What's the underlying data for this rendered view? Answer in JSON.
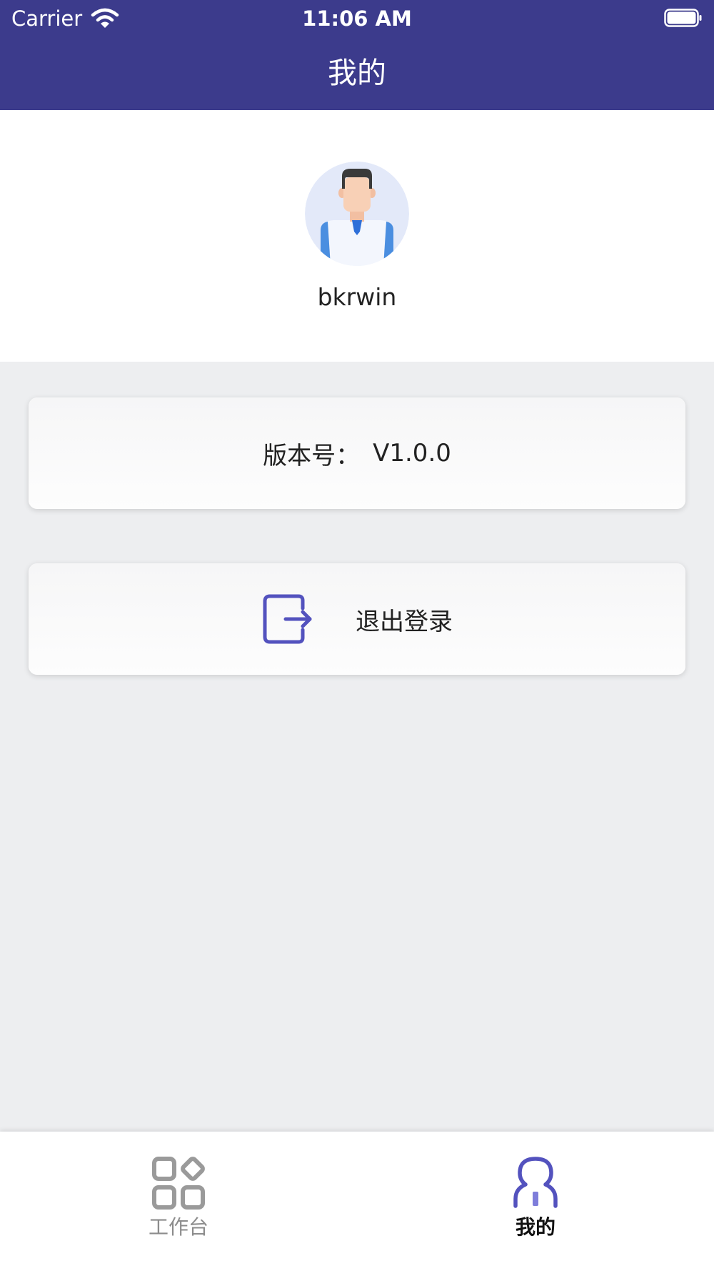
{
  "status_bar": {
    "carrier": "Carrier",
    "time": "11:06 AM",
    "battery_level": 1.0
  },
  "nav": {
    "title": "我的"
  },
  "profile": {
    "avatar_icon": "user-avatar",
    "username": "bkrwin"
  },
  "version_card": {
    "label": "版本号：",
    "value": "V1.0.0"
  },
  "logout_card": {
    "icon": "logout-icon",
    "label": "退出登录"
  },
  "tabs": [
    {
      "label": "工作台",
      "icon": "grid-icon",
      "active": false
    },
    {
      "label": "我的",
      "icon": "person-icon",
      "active": true
    }
  ],
  "colors": {
    "nav_background": "#3C3B8C",
    "accent": "#5352BE",
    "page_background": "#EDEEF0",
    "inactive_tab": "#8C8C8C"
  }
}
